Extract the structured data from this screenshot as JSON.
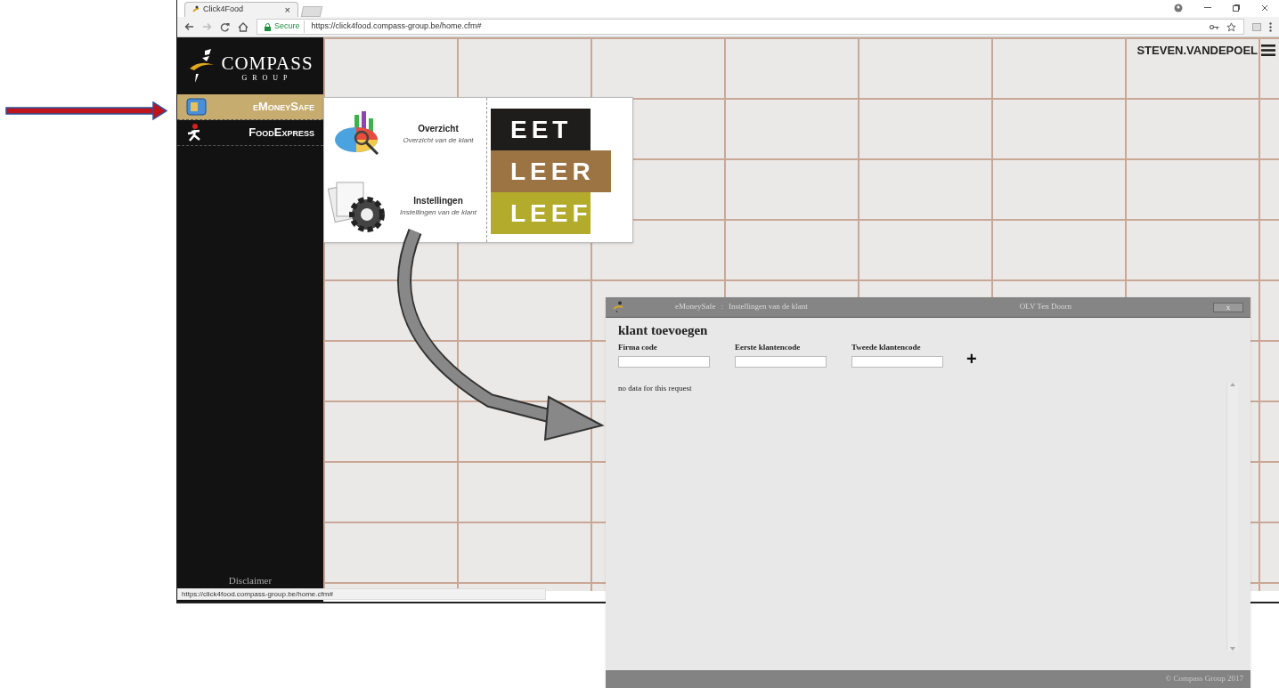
{
  "browser": {
    "tab_title": "Click4Food",
    "tab_close": "×",
    "security_label": "Secure",
    "url": "https://click4food.compass-group.be/home.cfm#",
    "status_url": "https://click4food.compass-group.be/home.cfm#"
  },
  "site": {
    "logo": {
      "name": "COMPASS",
      "sub": "GROUP"
    },
    "nav": [
      {
        "label": "eMoneySafe",
        "kind": "wallet",
        "selected": true
      },
      {
        "label": "FoodExpress",
        "kind": "runner",
        "selected": false
      }
    ],
    "disclaimer": "Disclaimer",
    "user": "STEVEN.VANDEPOEL"
  },
  "menu": {
    "items": [
      {
        "title": "Overzicht",
        "subtitle": "Overzicht van de klant",
        "kind": "chart"
      },
      {
        "title": "Instellingen",
        "subtitle": "Instellingen van de klant",
        "kind": "settings"
      }
    ],
    "banner": [
      {
        "text": "EET",
        "color": "#1f1d1b"
      },
      {
        "text": "LEER",
        "color": "#9c7443"
      },
      {
        "text": "LEEF",
        "color": "#b3ab2b"
      }
    ]
  },
  "dialog": {
    "app": "eMoneySafe",
    "separator": ":",
    "page": "Instellingen van de klant",
    "location": "OLV Ten Doorn",
    "close": "x",
    "heading": "klant toevoegen",
    "fields": [
      {
        "label": "Firma code"
      },
      {
        "label": "Eerste klantencode"
      },
      {
        "label": "Tweede klantencode"
      }
    ],
    "add": "+",
    "message": "no data for this request",
    "footer": "© Compass Group 2017"
  }
}
